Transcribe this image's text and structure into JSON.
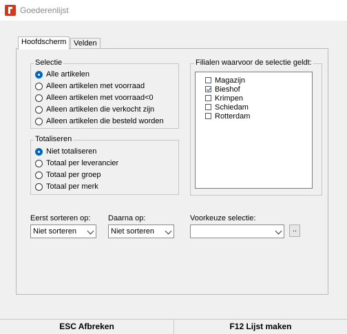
{
  "window": {
    "title": "Goederenlijst"
  },
  "tabs": [
    {
      "label": "Hoofdscherm",
      "active": true
    },
    {
      "label": "Velden",
      "active": false
    }
  ],
  "selectie": {
    "legend": "Selectie",
    "options": [
      {
        "label": "Alle artikelen",
        "checked": true
      },
      {
        "label": "Alleen artikelen met voorraad",
        "checked": false
      },
      {
        "label": "Alleen artikelen met voorraad<0",
        "checked": false
      },
      {
        "label": "Alleen artikelen die verkocht zijn",
        "checked": false
      },
      {
        "label": "Alleen artikelen die besteld worden",
        "checked": false
      }
    ]
  },
  "totaliseren": {
    "legend": "Totaliseren",
    "options": [
      {
        "label": "Niet totaliseren",
        "checked": true
      },
      {
        "label": "Totaal per leverancier",
        "checked": false
      },
      {
        "label": "Totaal per groep",
        "checked": false
      },
      {
        "label": "Totaal per merk",
        "checked": false
      }
    ]
  },
  "filialen": {
    "legend": "Filialen waarvoor de selectie geldt:",
    "items": [
      {
        "label": "Magazijn",
        "checked": false
      },
      {
        "label": "Bieshof",
        "checked": true
      },
      {
        "label": "Krimpen",
        "checked": false
      },
      {
        "label": "Schiedam",
        "checked": false
      },
      {
        "label": "Rotterdam",
        "checked": false
      }
    ]
  },
  "sort": {
    "first_label": "Eerst sorteren op:",
    "first_value": "Niet sorteren",
    "then_label": "Daarna op:",
    "then_value": "Niet sorteren"
  },
  "voorkeuze": {
    "label": "Voorkeuze selectie:",
    "value": "",
    "browse_label": ".."
  },
  "footer": {
    "cancel_label": "ESC Afbreken",
    "ok_label": "F12 Lijst maken"
  }
}
